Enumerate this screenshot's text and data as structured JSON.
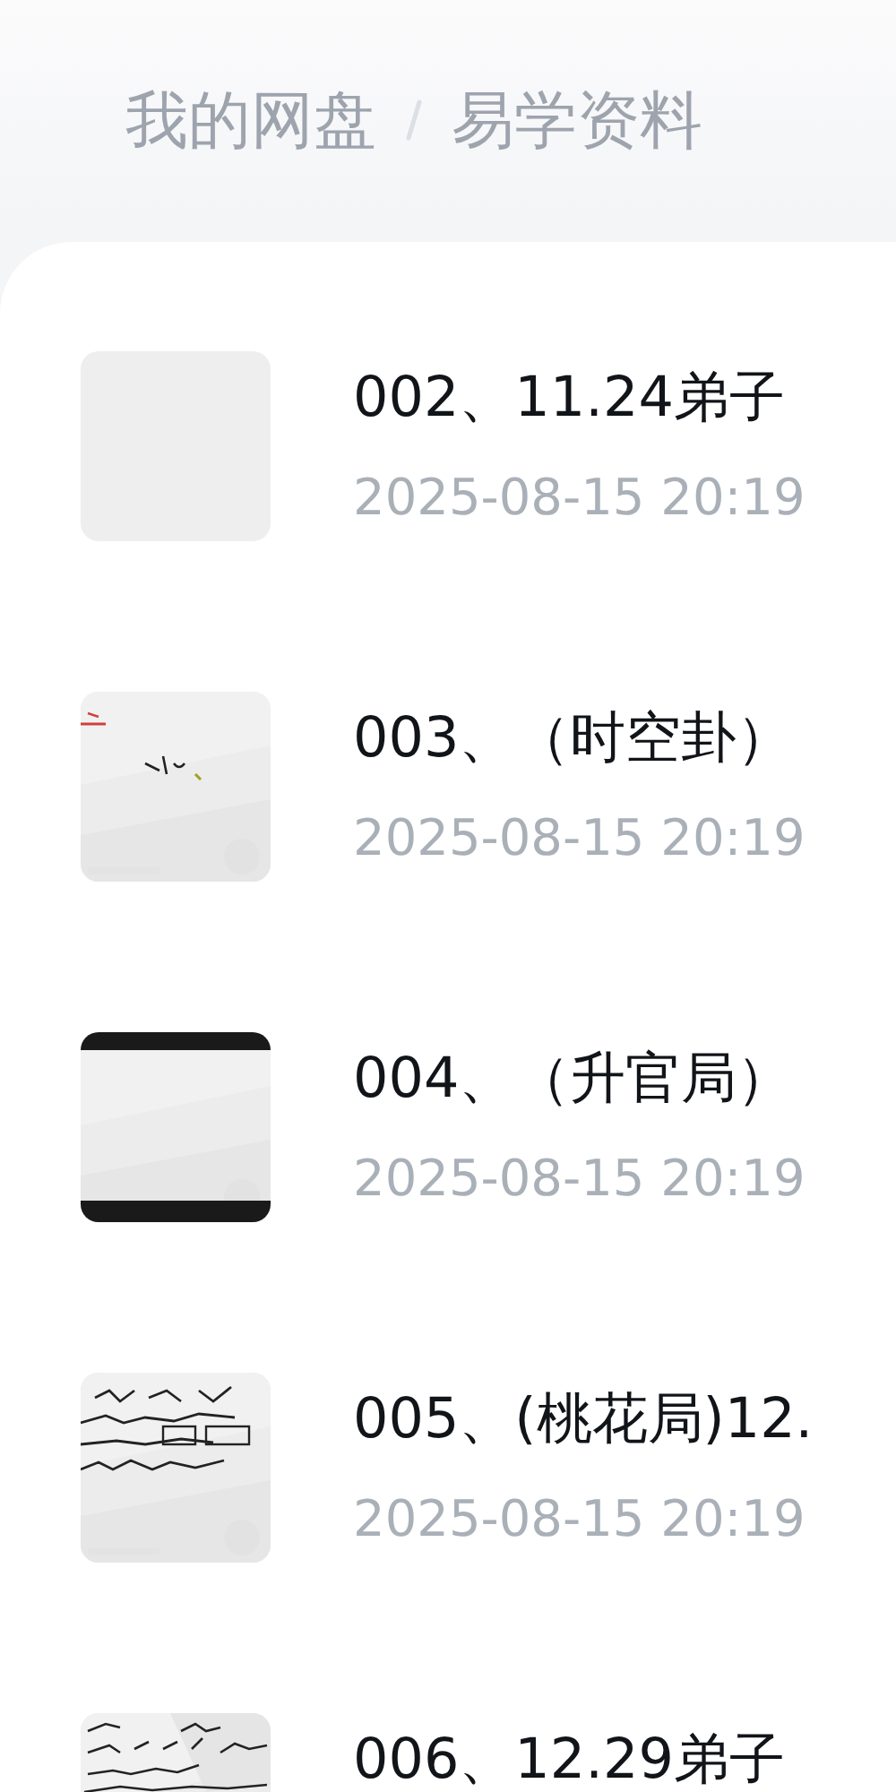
{
  "breadcrumb": [
    {
      "label": "我的网盘"
    },
    {
      "label": "易学资料"
    }
  ],
  "files": [
    {
      "title": "002、11.24弟子",
      "meta": "2025-08-15  20:19",
      "kind": "blank"
    },
    {
      "title": "003、（时空卦）",
      "meta": "2025-08-15  20:19",
      "kind": "picture"
    },
    {
      "title": "004、（升官局）",
      "meta": "2025-08-15  20:19",
      "kind": "picture"
    },
    {
      "title": "005、(桃花局)12.",
      "meta": "2025-08-15  20:19",
      "kind": "picture"
    },
    {
      "title": "006、12.29弟子",
      "kind": "picture"
    }
  ]
}
